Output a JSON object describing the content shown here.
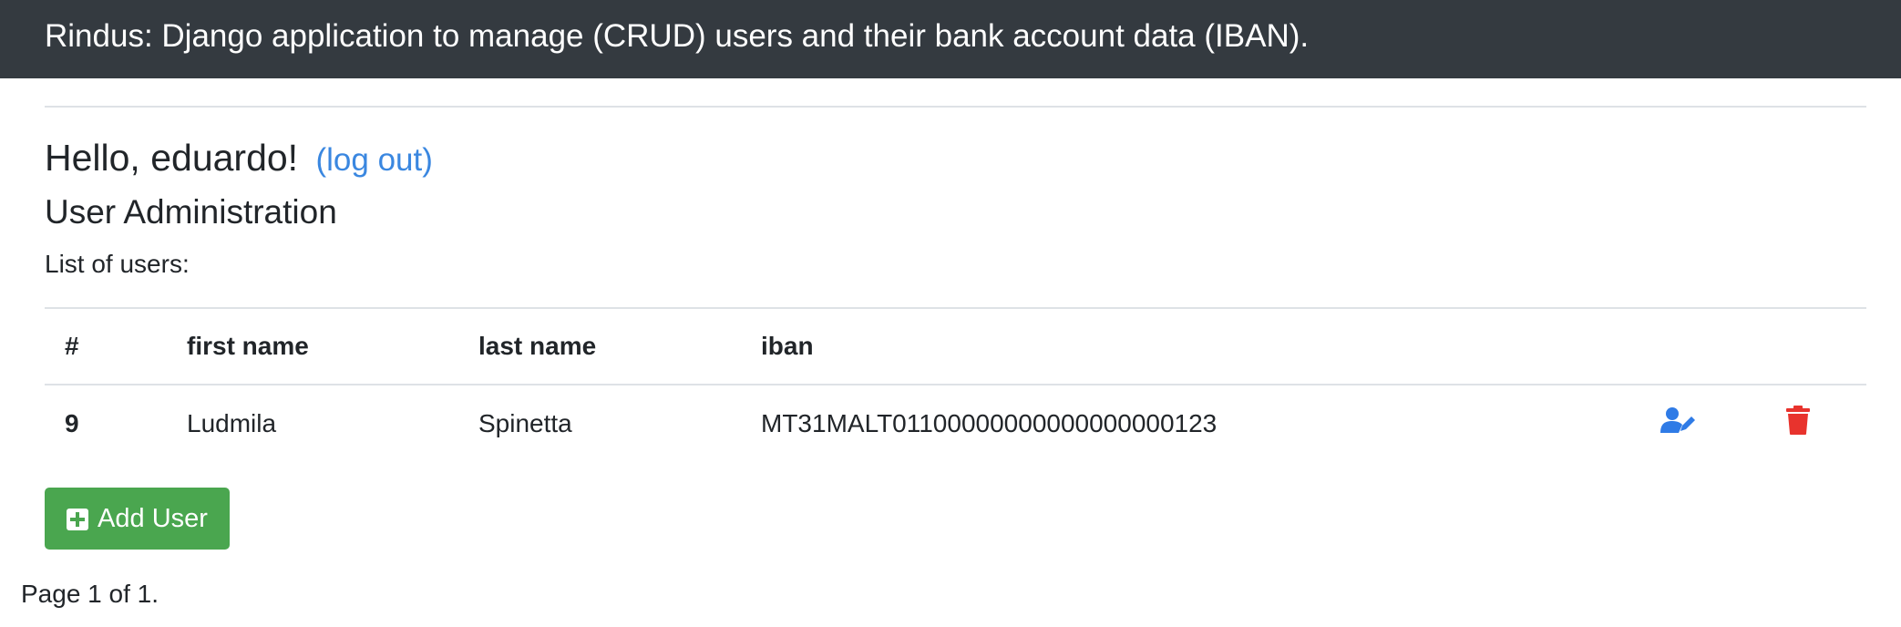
{
  "header": {
    "title": "Rindus: Django application to manage (CRUD) users and their bank account data (IBAN)."
  },
  "greeting": {
    "text": "Hello, eduardo!",
    "logout_label": "(log out)"
  },
  "section_title": "User Administration",
  "list_label": "List of users:",
  "table": {
    "columns": [
      "#",
      "first name",
      "last name",
      "iban"
    ],
    "rows": [
      {
        "id": "9",
        "first_name": "Ludmila",
        "last_name": "Spinetta",
        "iban": "MT31MALT01100000000000000000123"
      }
    ]
  },
  "icons": {
    "edit": "user-edit-icon",
    "delete": "trash-icon",
    "add": "plus-square-icon"
  },
  "add_button_label": "Add User",
  "pagination": "Page 1 of 1.",
  "colors": {
    "navbar": "#343a40",
    "link": "#3a87e0",
    "edit_icon": "#2f7be6",
    "delete_icon": "#e8332d",
    "add_button": "#4aa64f"
  }
}
